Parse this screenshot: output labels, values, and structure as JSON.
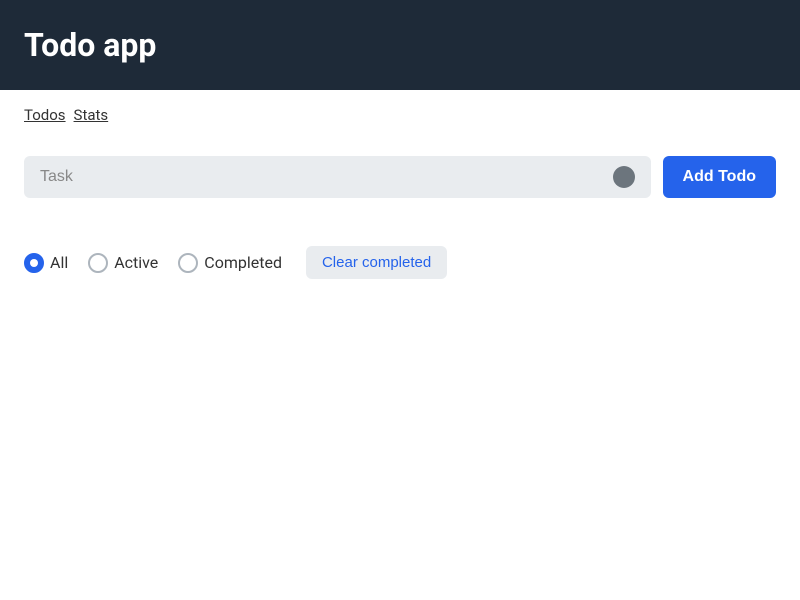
{
  "header": {
    "title": "Todo app"
  },
  "nav": {
    "todos_label": "Todos",
    "stats_label": "Stats"
  },
  "input": {
    "placeholder": "Task",
    "add_button_label": "Add Todo"
  },
  "filters": {
    "all_label": "All",
    "active_label": "Active",
    "completed_label": "Completed",
    "clear_button_label": "Clear completed",
    "selected": "all"
  },
  "colors": {
    "header_bg": "#1e2a38",
    "add_btn_bg": "#2563eb",
    "clear_btn_color": "#2563eb",
    "radio_selected": "#2563eb"
  }
}
